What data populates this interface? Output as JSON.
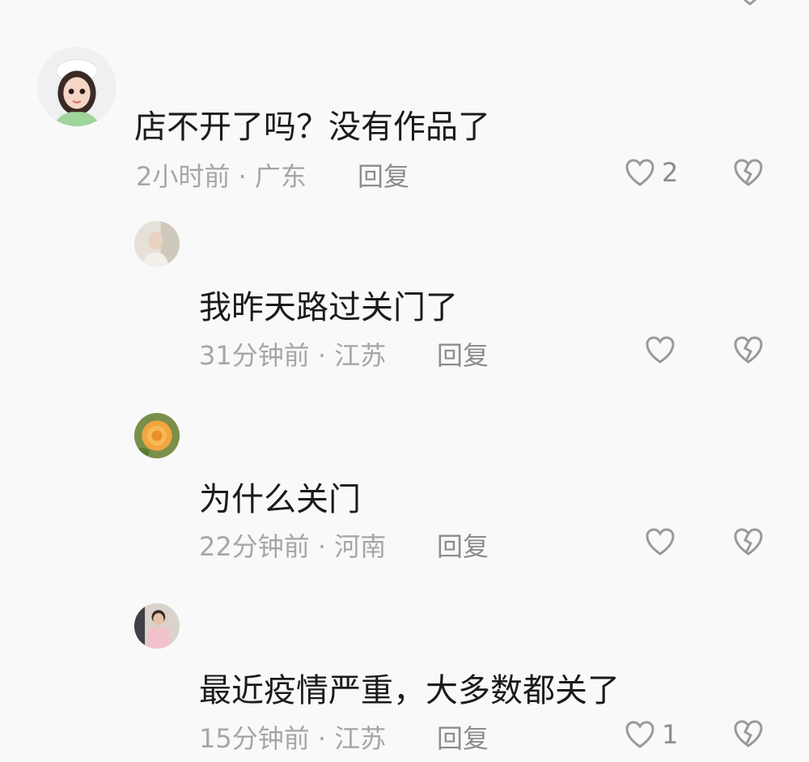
{
  "comments": [
    {
      "text": "店不开了吗？没有作品了",
      "time": "2小时前",
      "location": "广东",
      "reply_label": "回复",
      "likes": "2",
      "avatar_icon": "chef-girl-avatar"
    },
    {
      "text": "我昨天路过关门了",
      "time": "31分钟前",
      "location": "江苏",
      "reply_label": "回复",
      "likes": "",
      "avatar_icon": "portrait-photo-avatar"
    },
    {
      "text": "为什么关门",
      "time": "22分钟前",
      "location": "河南",
      "reply_label": "回复",
      "likes": "",
      "avatar_icon": "orange-rose-avatar"
    },
    {
      "text": "最近疫情严重，大多数都关了",
      "time": "15分钟前",
      "location": "江苏",
      "reply_label": "回复",
      "likes": "1",
      "avatar_icon": "boy-photo-avatar"
    }
  ],
  "separator": " · "
}
